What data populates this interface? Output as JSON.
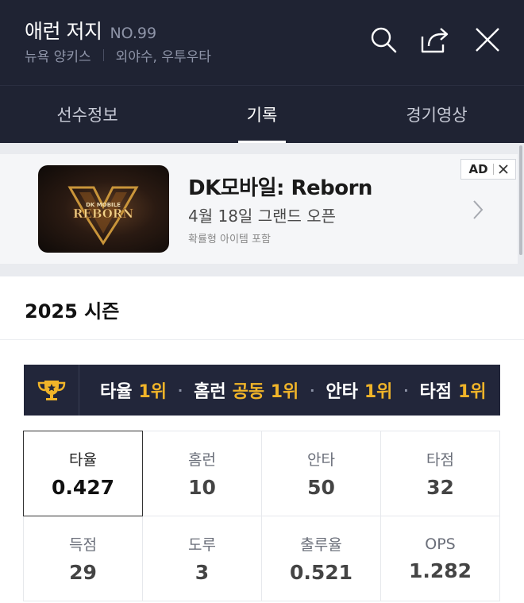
{
  "header": {
    "player_name": "애런 저지",
    "player_number": "NO.99",
    "team": "뉴욕 양키스",
    "position": "외야수, 우투우타",
    "icons": [
      "search-icon",
      "share-icon",
      "close-icon"
    ]
  },
  "tabs": [
    {
      "label": "선수정보",
      "active": false
    },
    {
      "label": "기록",
      "active": true
    },
    {
      "label": "경기영상",
      "active": false
    }
  ],
  "ad": {
    "title": "DK모바일: Reborn",
    "subtitle": "4월 18일 그랜드 오픈",
    "note": "확률형 아이템 포함",
    "badge": "AD",
    "thumb_logo_top": "DK MOBILE",
    "thumb_logo_main": "REBORN"
  },
  "season": {
    "title": "2025 시즌"
  },
  "rankings": [
    {
      "label": "타율",
      "value": "1위"
    },
    {
      "label": "홈런",
      "value": "공동 1위"
    },
    {
      "label": "안타",
      "value": "1위"
    },
    {
      "label": "타점",
      "value": "1위"
    }
  ],
  "stats": [
    {
      "label": "타율",
      "value": "0.427",
      "selected": true
    },
    {
      "label": "홈런",
      "value": "10",
      "selected": false
    },
    {
      "label": "안타",
      "value": "50",
      "selected": false
    },
    {
      "label": "타점",
      "value": "32",
      "selected": false
    },
    {
      "label": "득점",
      "value": "29",
      "selected": false
    },
    {
      "label": "도루",
      "value": "3",
      "selected": false
    },
    {
      "label": "출루율",
      "value": "0.521",
      "selected": false
    },
    {
      "label": "OPS",
      "value": "1.282",
      "selected": false
    }
  ],
  "colors": {
    "header_bg": "#1f2333",
    "accent_gold": "#f0b429",
    "rank_bar_bg": "#22263a"
  }
}
